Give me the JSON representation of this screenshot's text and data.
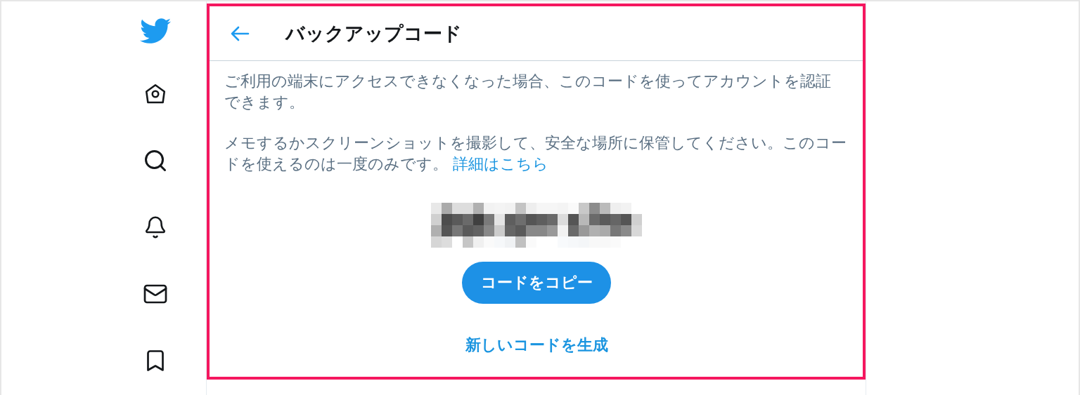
{
  "header": {
    "title": "バックアップコード"
  },
  "paragraphs": [
    {
      "text": "ご利用の端末にアクセスできなくなった場合、このコードを使ってアカウントを認証できます。"
    },
    {
      "text": "メモするかスクリーンショットを撮影して、安全な場所に保管してください。このコードを使えるのは一度のみです。",
      "link": "詳細はこちら"
    }
  ],
  "copy_button": {
    "label": "コードをコピー"
  },
  "generate_link": {
    "label": "新しいコードを生成"
  }
}
